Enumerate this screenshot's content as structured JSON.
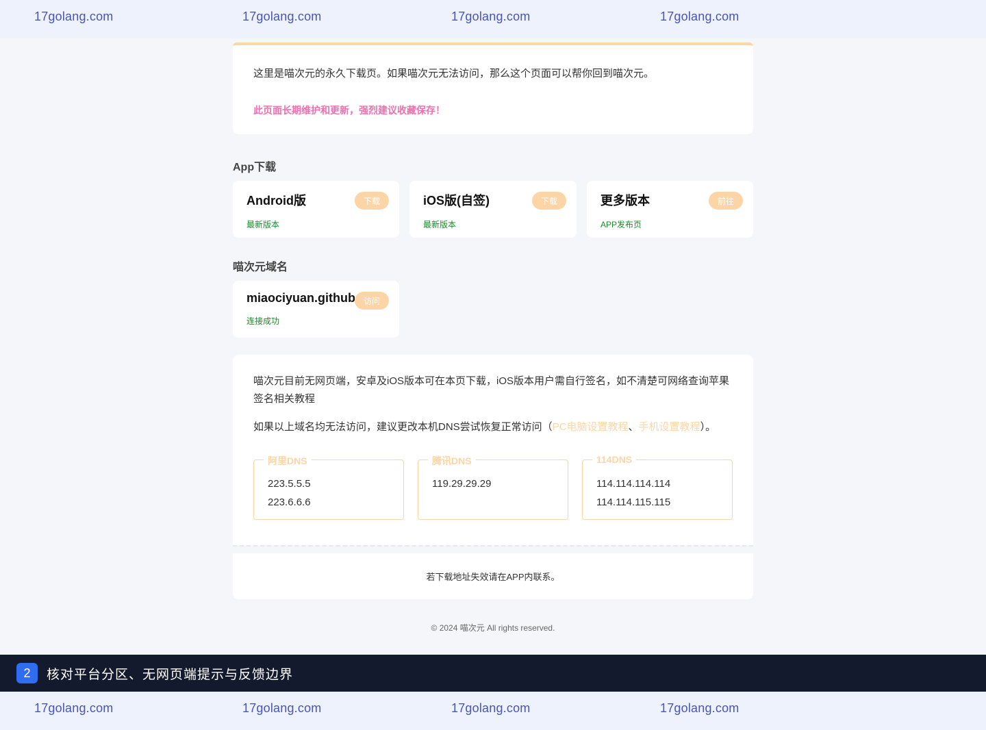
{
  "watermark": {
    "text": "17golang.com"
  },
  "intro": {
    "text": "这里是喵次元的永久下载页。如果喵次元无法访问，那么这个页面可以帮你回到喵次元。",
    "notice": "此页面长期维护和更新，强烈建议收藏保存！"
  },
  "app_section": {
    "title": "App下载",
    "cards": [
      {
        "name": "Android版",
        "sub": "最新版本",
        "action": "下载"
      },
      {
        "name": "iOS版(自签)",
        "sub": "最新版本",
        "action": "下载"
      },
      {
        "name": "更多版本",
        "sub": "APP发布页",
        "action": "前往"
      }
    ]
  },
  "domain_section": {
    "title": "喵次元域名",
    "card": {
      "name": "miaociyuan.github.io",
      "sub": "连接成功",
      "action": "访问"
    }
  },
  "info": {
    "p1": "喵次元目前无网页端，安卓及iOS版本可在本页下载，iOS版本用户需自行签名，如不清楚可网络查询苹果签名相关教程",
    "p2_prefix": "如果以上域名均无法访问，建议更改本机DNS尝试恢复正常访问（",
    "p2_link1": "PC电脑设置教程",
    "p2_sep": "、",
    "p2_link2": "手机设置教程",
    "p2_suffix": "）。",
    "dns": [
      {
        "label": "阿里DNS",
        "ips": [
          "223.5.5.5",
          "223.6.6.6"
        ]
      },
      {
        "label": "腾讯DNS",
        "ips": [
          "119.29.29.29"
        ]
      },
      {
        "label": "114DNS",
        "ips": [
          "114.114.114.114",
          "114.114.115.115"
        ]
      }
    ]
  },
  "footer": {
    "note": "若下载地址失效请在APP内联系。",
    "copyright": "© 2024 喵次元 All rights reserved."
  },
  "task": {
    "number": "2",
    "label": "核对平台分区、无网页端提示与反馈边界"
  },
  "colors": {
    "accent": "#fcd5a6",
    "pink": "#f06fae",
    "green": "#1a8a2a",
    "task_bg": "#141a2e",
    "task_num": "#2f6df0"
  }
}
